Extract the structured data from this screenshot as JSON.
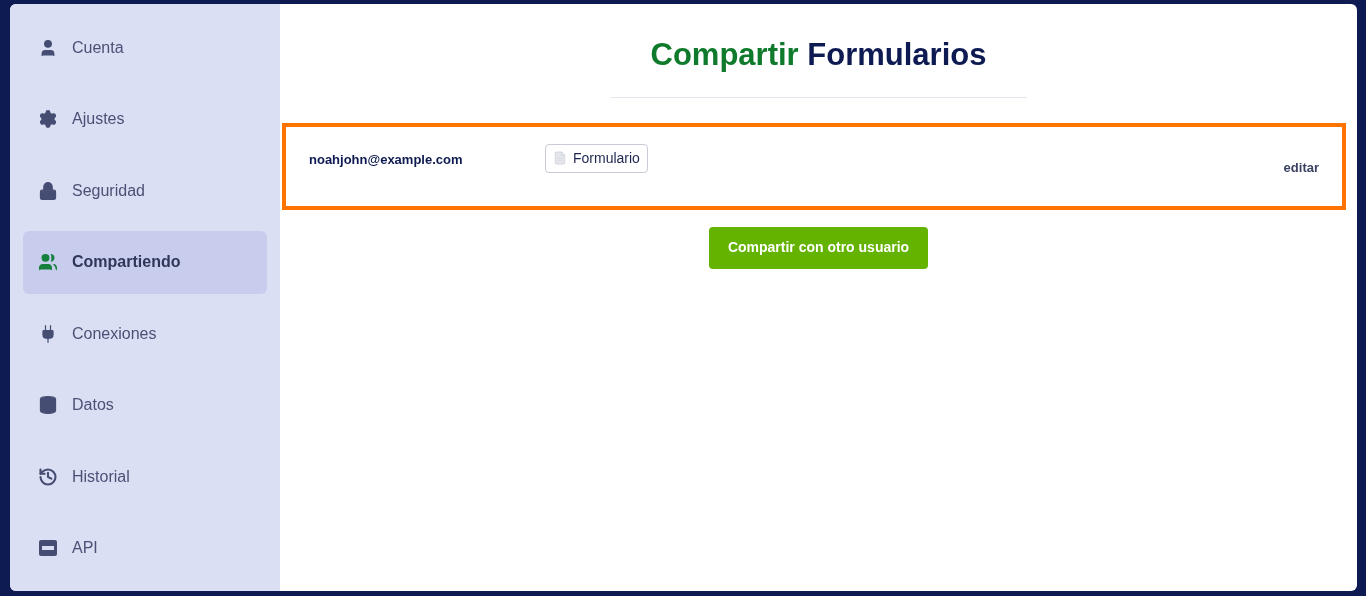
{
  "sidebar": {
    "items": [
      {
        "label": "Cuenta",
        "kind": "user",
        "selected": false
      },
      {
        "label": "Ajustes",
        "kind": "gear",
        "selected": false
      },
      {
        "label": "Seguridad",
        "kind": "lock",
        "selected": false
      },
      {
        "label": "Compartiendo",
        "kind": "users",
        "selected": true
      },
      {
        "label": "Conexiones",
        "kind": "plug",
        "selected": false
      },
      {
        "label": "Datos",
        "kind": "database",
        "selected": false
      },
      {
        "label": "Historial",
        "kind": "history",
        "selected": false
      },
      {
        "label": "API",
        "kind": "api",
        "selected": false
      }
    ]
  },
  "title": {
    "accent": "Compartir",
    "rest": "Formularios"
  },
  "shares": [
    {
      "email": "noahjohn@example.com",
      "forms": [
        "Formulario"
      ],
      "action": "editar",
      "highlighted": true
    }
  ],
  "share_button": "Compartir con otro usuario"
}
